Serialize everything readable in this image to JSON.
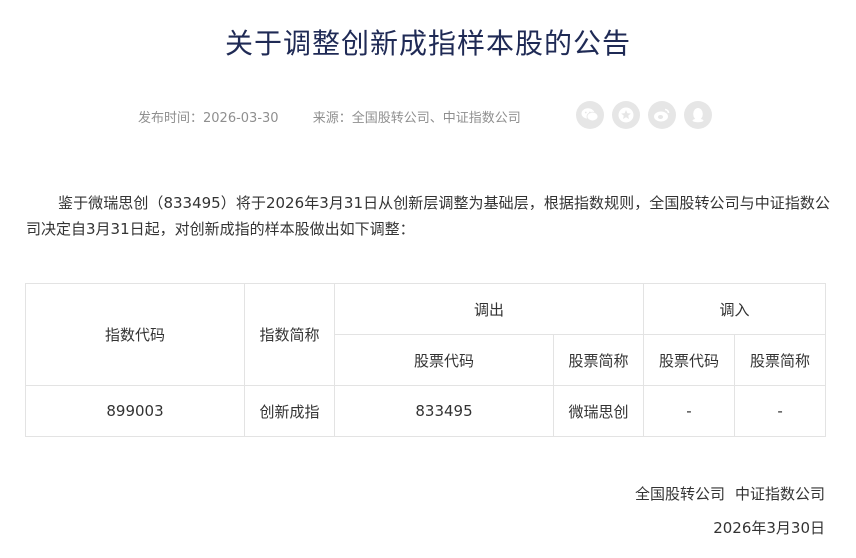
{
  "title": "关于调整创新成指样本股的公告",
  "meta": {
    "publish_label": "发布时间：",
    "publish_date": "2026-03-30",
    "source_label": "来源：",
    "source": "全国股转公司、中证指数公司"
  },
  "share_icons": [
    "wechat-icon",
    "star-icon",
    "weibo-icon",
    "qq-icon"
  ],
  "body": "鉴于微瑞思创（833495）将于2026年3月31日从创新层调整为基础层，根据指数规则，全国股转公司与中证指数公司决定自3月31日起，对创新成指的样本股做出如下调整：",
  "table": {
    "headers": {
      "index_code": "指数代码",
      "index_name": "指数简称",
      "out": "调出",
      "in": "调入",
      "out_stock_code": "股票代码",
      "out_stock_name": "股票简称",
      "in_stock_code": "股票代码",
      "in_stock_name": "股票简称"
    },
    "rows": [
      {
        "index_code": "899003",
        "index_name": "创新成指",
        "out_code": "833495",
        "out_name": "微瑞思创",
        "in_code": "-",
        "in_name": "-"
      }
    ]
  },
  "footer": {
    "org1": "全国股转公司",
    "org2": "中证指数公司",
    "date": "2026年3月30日"
  },
  "colors": {
    "title": "#1f2a55",
    "meta": "#8f8f8f",
    "text": "#333333",
    "border": "#e3e3e3",
    "icon_bg": "#e6e6e6"
  }
}
